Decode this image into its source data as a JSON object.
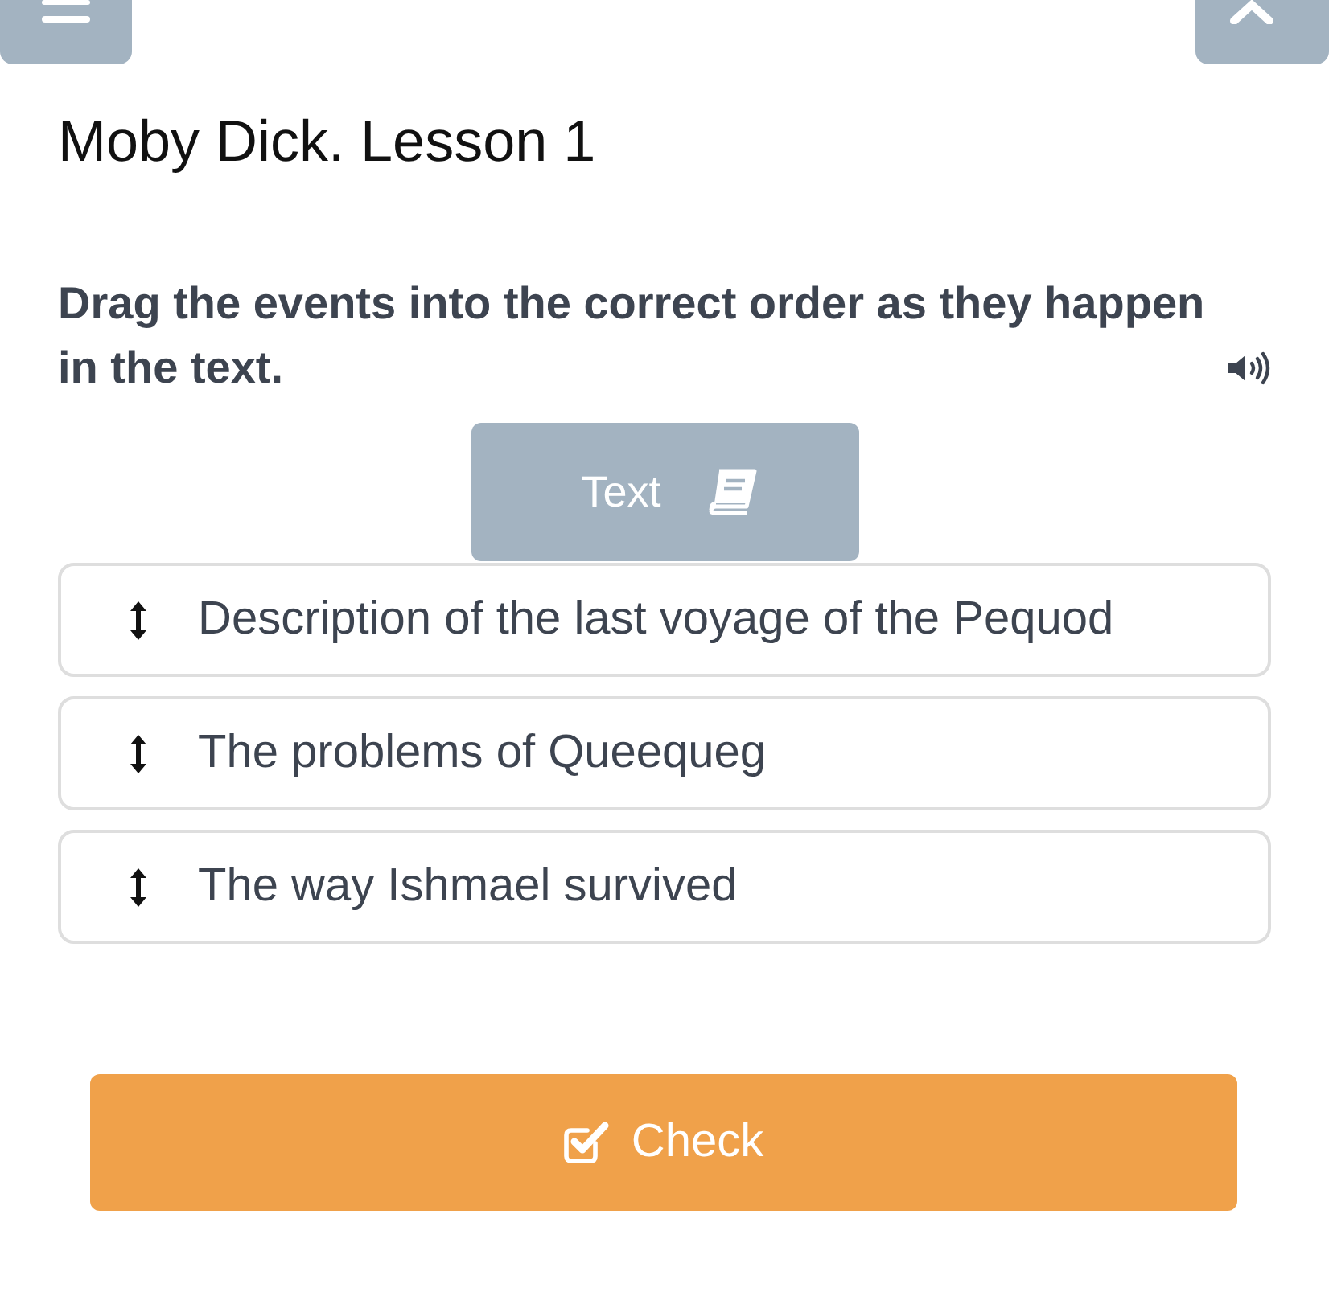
{
  "lesson": {
    "title": "Moby Dick. Lesson 1"
  },
  "task": {
    "instruction": "Drag the events into the correct order as they happen in the text.",
    "text_button": "Text"
  },
  "items": [
    {
      "label": "Description of the last voyage of the Pequod"
    },
    {
      "label": "The problems of Queequeg"
    },
    {
      "label": "The way Ishmael survived"
    }
  ],
  "check_button": "Check"
}
